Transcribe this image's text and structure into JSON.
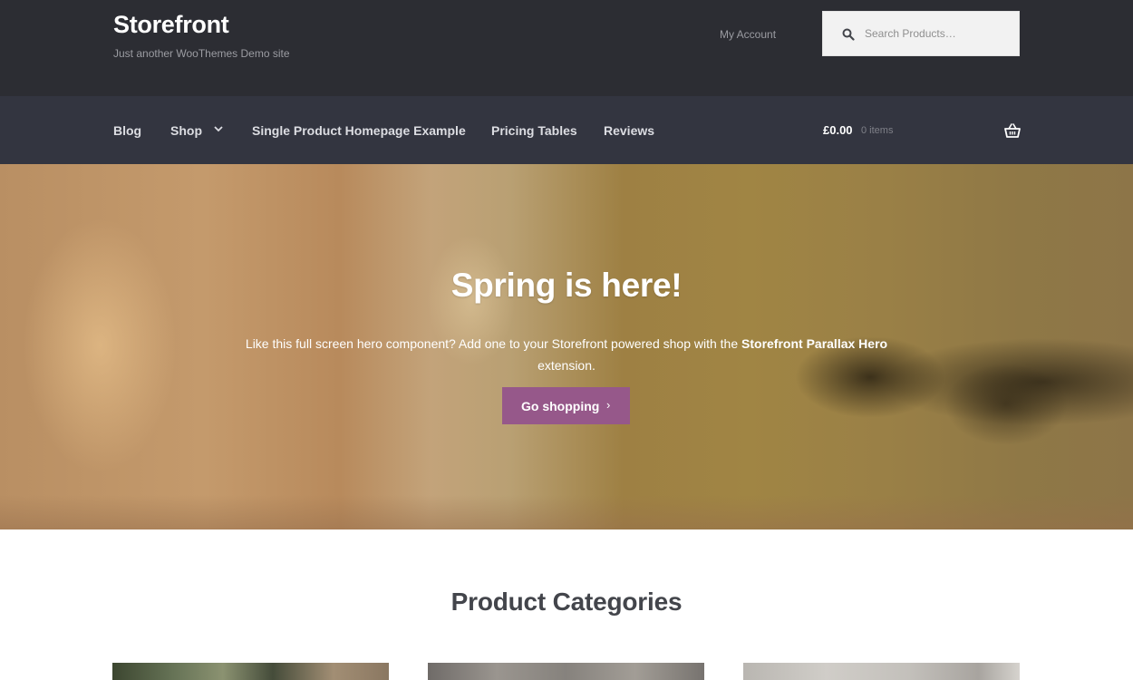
{
  "site": {
    "title": "Storefront",
    "tagline": "Just another WooThemes Demo site"
  },
  "header": {
    "my_account": "My Account",
    "search_placeholder": "Search Products…"
  },
  "nav": {
    "items": [
      "Blog",
      "Shop",
      "Single Product Homepage Example",
      "Pricing Tables",
      "Reviews"
    ]
  },
  "cart": {
    "amount": "£0.00",
    "count": "0 items"
  },
  "hero": {
    "title": "Spring is here!",
    "text_before": "Like this full screen hero component? Add one to your Storefront powered shop with the ",
    "text_bold": "Storefront Parallax Hero",
    "text_after": " extension.",
    "button_label": "Go shopping",
    "button_arrow": "›"
  },
  "section": {
    "title": "Product Categories"
  },
  "colors": {
    "header_bg": "#2c2d33",
    "nav_bg": "#333540",
    "accent": "#96588a",
    "heading": "#43454b"
  },
  "icons": {
    "search": "search-icon",
    "cart": "basket-icon",
    "dropdown": "chevron-down-icon"
  }
}
